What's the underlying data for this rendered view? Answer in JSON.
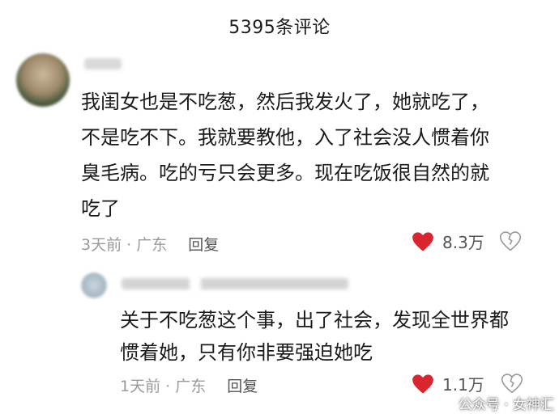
{
  "header": {
    "title": "5395条评论"
  },
  "comment": {
    "username": "",
    "lines": [
      "我闺女也是不吃葱，然后我发火了，她就吃了，",
      "不是吃不下。我就要教他，入了社会没人惯着你",
      "臭毛病。吃的亏只会更多。现在吃饭很自然的就",
      "吃了"
    ],
    "time": "3天前 · 广东",
    "reply_label": "回复",
    "likes": "8.3万"
  },
  "reply": {
    "lines": [
      "关于不吃葱这个事，出了社会，发现全世界都",
      "惯着她，只有你非要强迫她吃"
    ],
    "time": "1天前 · 广东",
    "reply_label": "回复",
    "likes": "1.1万"
  },
  "watermark": {
    "text": "公众号 · 女神汇"
  },
  "colors": {
    "heart": "#d9252e",
    "meta": "#9a9a9a"
  }
}
